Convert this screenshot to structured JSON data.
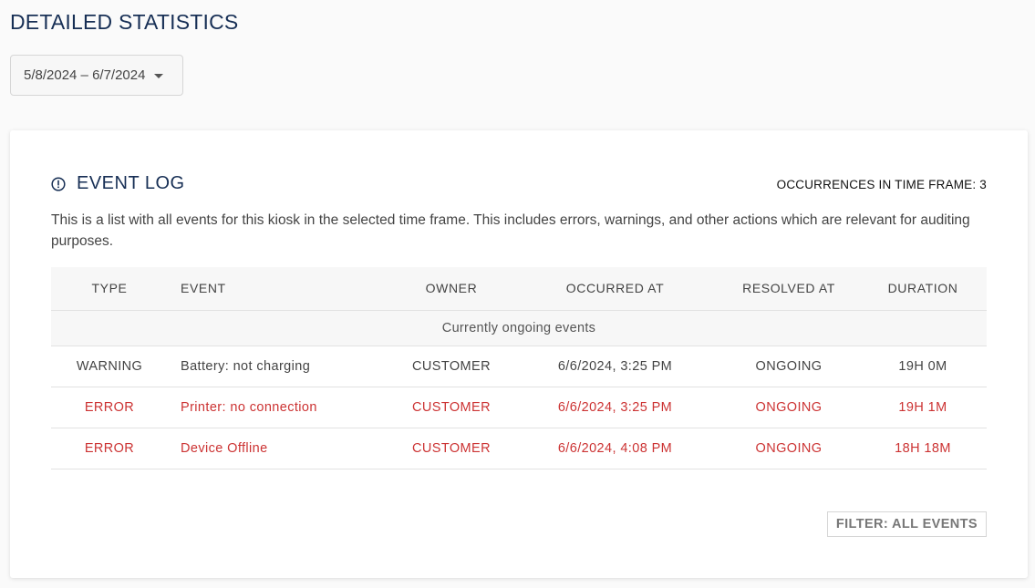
{
  "page": {
    "title": "DETAILED STATISTICS"
  },
  "date_range": {
    "value": "5/8/2024 – 6/7/2024"
  },
  "event_log": {
    "title": "EVENT LOG",
    "occurrences_label": "OCCURRENCES IN TIME FRAME: 3",
    "description": "This is a list with all events for this kiosk in the selected time frame. This includes errors, warnings, and other actions which are relevant for auditing purposes.",
    "columns": {
      "type": "TYPE",
      "event": "EVENT",
      "owner": "OWNER",
      "occurred_at": "OCCURRED AT",
      "resolved_at": "RESOLVED AT",
      "duration": "DURATION"
    },
    "group_label": "Currently ongoing events",
    "rows": [
      {
        "type": "WARNING",
        "event": "Battery: not charging",
        "owner": "CUSTOMER",
        "occurred_at": "6/6/2024, 3:25 PM",
        "resolved_at": "ONGOING",
        "duration": "19H 0M"
      },
      {
        "type": "ERROR",
        "event": "Printer: no connection",
        "owner": "CUSTOMER",
        "occurred_at": "6/6/2024, 3:25 PM",
        "resolved_at": "ONGOING",
        "duration": "19H 1M"
      },
      {
        "type": "ERROR",
        "event": "Device Offline",
        "owner": "CUSTOMER",
        "occurred_at": "6/6/2024, 4:08 PM",
        "resolved_at": "ONGOING",
        "duration": "18H 18M"
      }
    ],
    "filter_button": "FILTER: ALL EVENTS"
  },
  "colors": {
    "title": "#172f55",
    "error": "#cc3333",
    "warning": "#444444"
  },
  "icons": {
    "header_icon": "alert-circle-icon",
    "dropdown_icon": "caret-down-icon"
  }
}
